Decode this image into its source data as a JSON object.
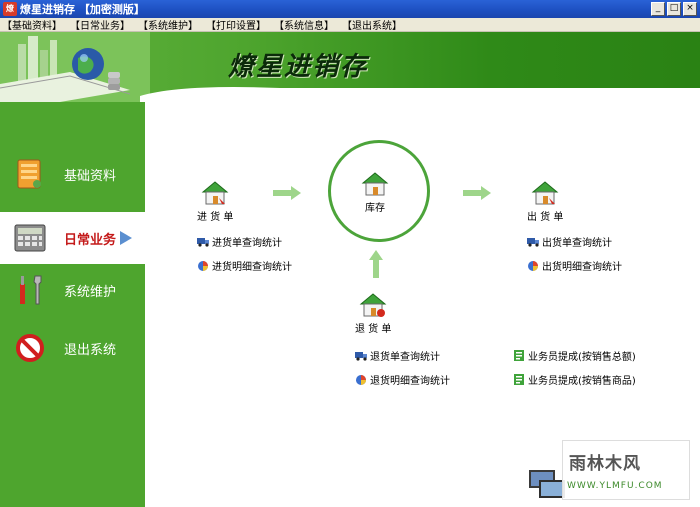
{
  "window": {
    "title": "燎星进销存 【加密测版】",
    "app_icon_glyph": "燎",
    "buttons": {
      "minimize": "_",
      "maximize": "□",
      "close": "×"
    }
  },
  "menu": [
    "【基础资料】",
    "【日常业务】",
    "【系统维护】",
    "【打印设置】",
    "【系统信息】",
    "【退出系统】"
  ],
  "banner": {
    "brand": "燎星进销存"
  },
  "sidebar": {
    "items": [
      {
        "label": "基础资料",
        "icon": "folder-icon"
      },
      {
        "label": "日常业务",
        "icon": "calculator-icon",
        "active": true
      },
      {
        "label": "系统维护",
        "icon": "tools-icon"
      },
      {
        "label": "退出系统",
        "icon": "exit-icon"
      }
    ]
  },
  "main": {
    "purchase": {
      "label": "进 货 单",
      "links": [
        "进货单查询统计",
        "进货明细查询统计"
      ]
    },
    "stock": {
      "label": "库存"
    },
    "sales": {
      "label": "出 货 单",
      "links": [
        "出货单查询统计",
        "出货明细查询统计"
      ]
    },
    "returns": {
      "label": "退 货 单",
      "links": [
        "退货单查询统计",
        "退货明细查询统计"
      ]
    },
    "commission": {
      "links": [
        "业务员提成(按销售总额)",
        "业务员提成(按销售商品)"
      ]
    }
  },
  "watermark": {
    "title": "雨林木风",
    "url": "WWW.YLMFU.COM"
  },
  "colors": {
    "brand_green": "#4ea52e",
    "active_red": "#c41a1a",
    "circle_green": "#4ca43a"
  }
}
